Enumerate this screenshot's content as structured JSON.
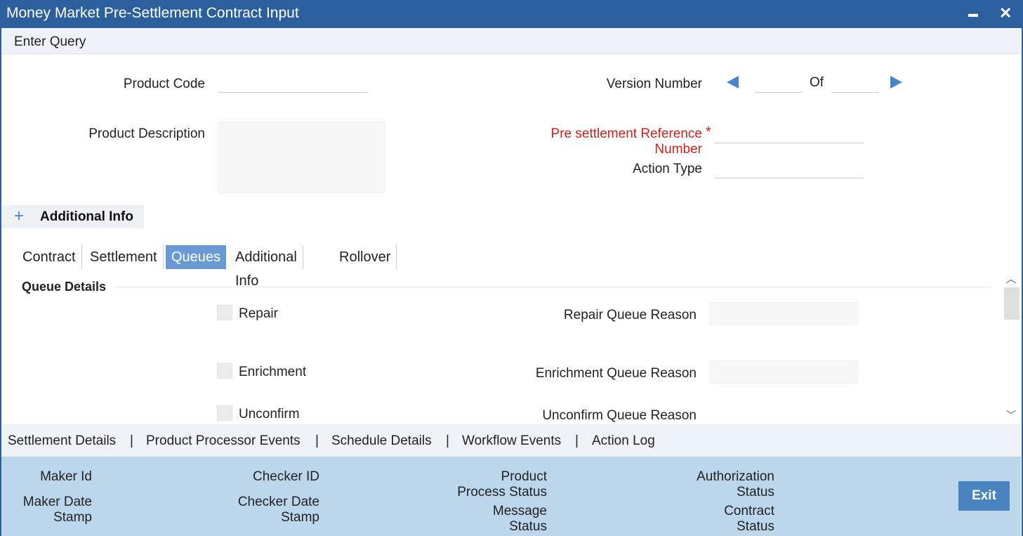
{
  "window": {
    "title": "Money Market Pre-Settlement Contract Input",
    "minimize_icon": "minimize-icon",
    "close_icon": "close-icon",
    "minimize_glyph": "▬",
    "close_glyph": "✕"
  },
  "toolbar": {
    "enter_query": "Enter Query"
  },
  "header": {
    "product_code_label": "Product Code",
    "product_code_value": "",
    "product_description_label": "Product Description",
    "version_number_label": "Version Number",
    "version_current": "",
    "version_of_label": "Of",
    "version_total": "",
    "pre_settlement_ref_label_line1": "Pre settlement Reference",
    "pre_settlement_ref_label_line2": "Number",
    "required_star": "*",
    "pre_settlement_ref_value": "",
    "action_type_label": "Action Type",
    "action_type_value": ""
  },
  "additional_info": {
    "toggle_glyph": "+",
    "label": "Additional Info"
  },
  "tabs": [
    {
      "label": "Contract"
    },
    {
      "label": "Settlement"
    },
    {
      "label": "Queues",
      "active": true
    },
    {
      "label": "Additional Info"
    },
    {
      "label": "Rollover"
    }
  ],
  "queue_details": {
    "section_title": "Queue Details",
    "repair_label": "Repair",
    "repair_reason_label": "Repair Queue Reason",
    "enrichment_label": "Enrichment",
    "enrichment_reason_label": "Enrichment Queue Reason",
    "unconfirm_label": "Unconfirm",
    "unconfirm_reason_label": "Unconfirm Queue Reason"
  },
  "scroll": {
    "up_glyph": "︿",
    "down_glyph": "﹀"
  },
  "subnav": {
    "links": [
      "Settlement Details",
      "Product Processor Events",
      "Schedule Details",
      "Workflow Events",
      "Action Log"
    ],
    "separator": "|"
  },
  "footer": {
    "maker_id": "Maker Id",
    "maker_date_line1": "Maker Date",
    "maker_date_line2": "Stamp",
    "checker_id": "Checker ID",
    "checker_date_line1": "Checker Date",
    "checker_date_line2": "Stamp",
    "product_process_line1": "Product",
    "product_process_line2": "Process Status",
    "message_status_line1": "Message",
    "message_status_line2": "Status",
    "authorization_line1": "Authorization",
    "authorization_line2": "Status",
    "contract_status_line1": "Contract",
    "contract_status_line2": "Status",
    "exit_label": "Exit"
  },
  "colors": {
    "titlebar": "#2b5f9e",
    "accent": "#4a84c9",
    "active_tab": "#6a9ad6",
    "footer_bg": "#bcd6ec",
    "required": "#d0211c"
  }
}
